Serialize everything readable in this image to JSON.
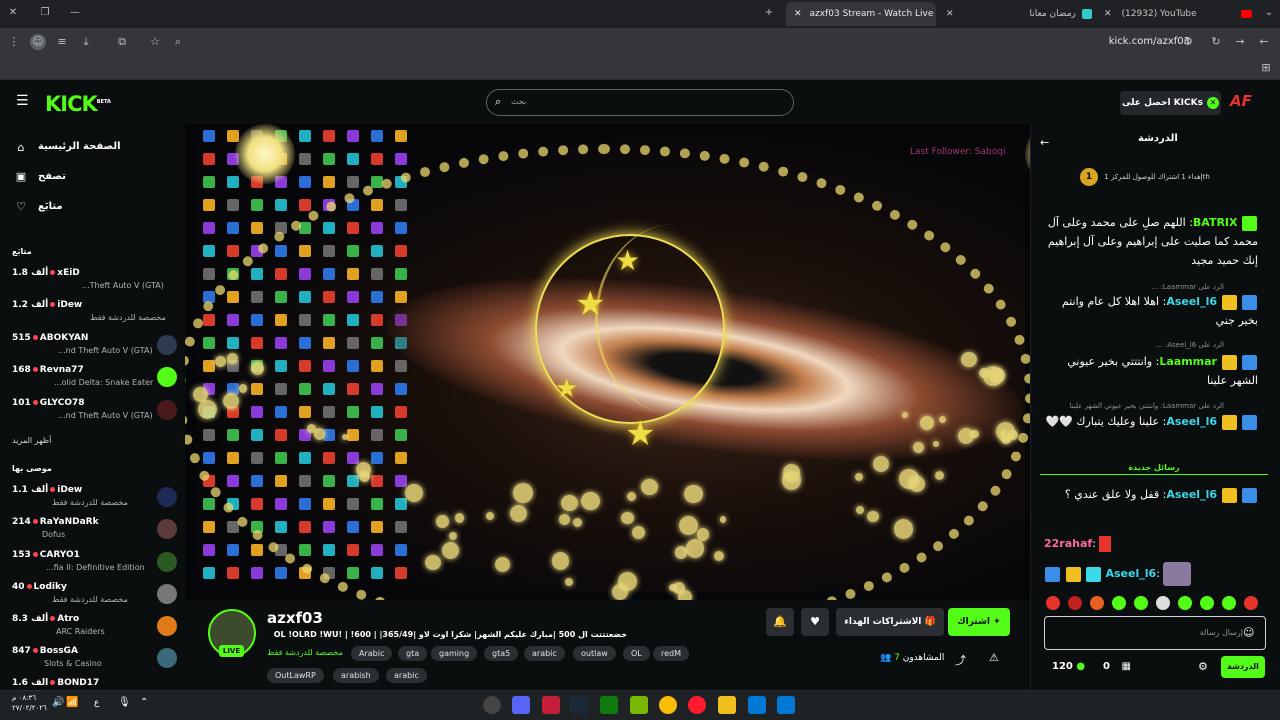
{
  "browser": {
    "tabs": [
      {
        "title": "azxf03 Stream - Watch Live on",
        "active": true
      },
      {
        "title": "رمضان معانا"
      },
      {
        "title": "(12932) YouTube"
      }
    ],
    "url": "kick.com/azxf03"
  },
  "header": {
    "logo": "KICK",
    "logo_sup": "BETA",
    "search_placeholder": "بحث",
    "kicks_button": "احصل على KICKs",
    "user_initials": "AF"
  },
  "sidebar": {
    "nav": [
      {
        "label": "الصفحة الرئيسية",
        "icon": "home-icon"
      },
      {
        "label": "تصفح",
        "icon": "browse-icon"
      },
      {
        "label": "متابَع",
        "icon": "heart-icon"
      }
    ],
    "following_title": "متابَع",
    "following": [
      {
        "name": "xEiD",
        "count": "1.8 ألف",
        "sub": "...Theft Auto V (GTA)"
      },
      {
        "name": "iDew",
        "count": "1.2 ألف",
        "sub": "مخصصة للدردشة فقط"
      },
      {
        "name": "ABOKYAN",
        "count": "515",
        "sub": "...nd Theft Auto V (GTA)"
      },
      {
        "name": "Revna77",
        "count": "168",
        "sub": "...olid Delta: Snake Eater"
      },
      {
        "name": "GLYCO78",
        "count": "101",
        "sub": "...nd Theft Auto V (GTA)"
      }
    ],
    "show_more": "أظهر المزيد",
    "recommended_title": "موصى بها",
    "recommended": [
      {
        "name": "iDew",
        "count": "1.1 ألف",
        "sub": "مخصصة للدردشة فقط"
      },
      {
        "name": "RaYaNDaRk",
        "count": "214",
        "sub": "Dofus"
      },
      {
        "name": "CARYO1",
        "count": "153",
        "sub": "...fia II: Definitive Edition"
      },
      {
        "name": "Lodiky",
        "count": "40",
        "sub": "مخصصة للدردشة فقط"
      },
      {
        "name": "Atro",
        "count": "8.3 ألف",
        "sub": "ARC Raiders"
      },
      {
        "name": "BossGA",
        "count": "847",
        "sub": "Slots & Casino"
      },
      {
        "name": "BOND17",
        "count": "1.6 ألف",
        "sub": ""
      }
    ]
  },
  "video": {
    "overlay_text": "Last Follower: Saboqi"
  },
  "stream": {
    "streamer": "azxf03",
    "live": "LIVE",
    "title": "خضعتتتت ال 500 |مبارك عليكم الشهر| شكرا اوت لاو |365/49| | 600! | !OL !OLRD !WU",
    "category": "مخصصة للدردشة فقط",
    "tags": [
      "Arabic",
      "gta",
      "gaming",
      "gta5",
      "arabic",
      "outlaw",
      "OL",
      "redM",
      "OutLawRP",
      "arabish",
      "arabic"
    ],
    "subscribe": "اشتراك",
    "gift_subs": "الاشتراكات الهداء",
    "viewers_label": "المشاهدون",
    "viewers": "7"
  },
  "chat": {
    "title": "الدردشة",
    "pinned": "إهداء 1 اشتراك للوصول للمركز 1th",
    "messages": [
      {
        "user": "BATRIX",
        "text": "اللهم صلِ على محمد وعلى آل محمد كما صليت على إبراهيم وعلى آل إبراهيم إنك حميد مجيد",
        "color": "#53fc18"
      },
      {
        "reply": "الرد على Laammar: ...",
        "user": "Aseel_l6",
        "text": "اهلا اهلا كل عام وانتم بخير جني",
        "color": "#3bd8e8"
      },
      {
        "reply": "الرد على Aseel_l6: ...",
        "user": "Laammar",
        "text": "وانتتتي بخير عيوني الشهر علينا",
        "color": "#53fc18"
      },
      {
        "reply": "الرد على Laammar: وانتتتي بخير عيوني الشهر علينا",
        "user": "Aseel_l6",
        "text": "علينا وعليك يتبارك 🤍🤍",
        "color": "#3bd8e8"
      }
    ],
    "new_messages": "رسائل جديدة",
    "messages2": [
      {
        "user": "Aseel_l6",
        "text": "قفل ولا علق عندي ؟",
        "color": "#3bd8e8"
      },
      {
        "user": "22rahaf",
        "text": "",
        "color": "#ff6b9a"
      },
      {
        "user": "Aseel_l6",
        "text": "",
        "color": "#3bd8e8"
      }
    ],
    "input_placeholder": "إرسال رسالة",
    "send": "الدردشة",
    "kicks": "120",
    "zero": "0"
  },
  "taskbar": {
    "time": "٠٨:٣٦ م",
    "date": "٢٧/٠٢/٢٠٢٦",
    "lang": "ع"
  }
}
